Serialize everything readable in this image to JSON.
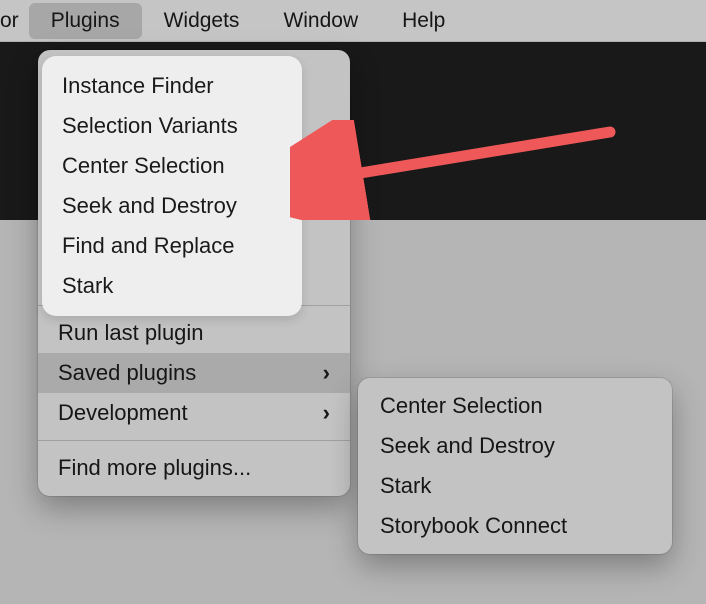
{
  "menubar": {
    "cut_item": "or",
    "items": [
      "Plugins",
      "Widgets",
      "Window",
      "Help"
    ],
    "active_index": 0
  },
  "dropdown": {
    "recent": [
      "Instance Finder",
      "Selection Variants",
      "Center Selection",
      "Seek and Destroy",
      "Find and Replace",
      "Stark"
    ],
    "run_last": "Run last plugin",
    "saved_plugins": "Saved plugins",
    "development": "Development",
    "find_more": "Find more plugins..."
  },
  "submenu": {
    "items": [
      "Center Selection",
      "Seek and Destroy",
      "Stark",
      "Storybook Connect"
    ]
  },
  "annotation": {
    "arrow_color": "#ef5858"
  }
}
